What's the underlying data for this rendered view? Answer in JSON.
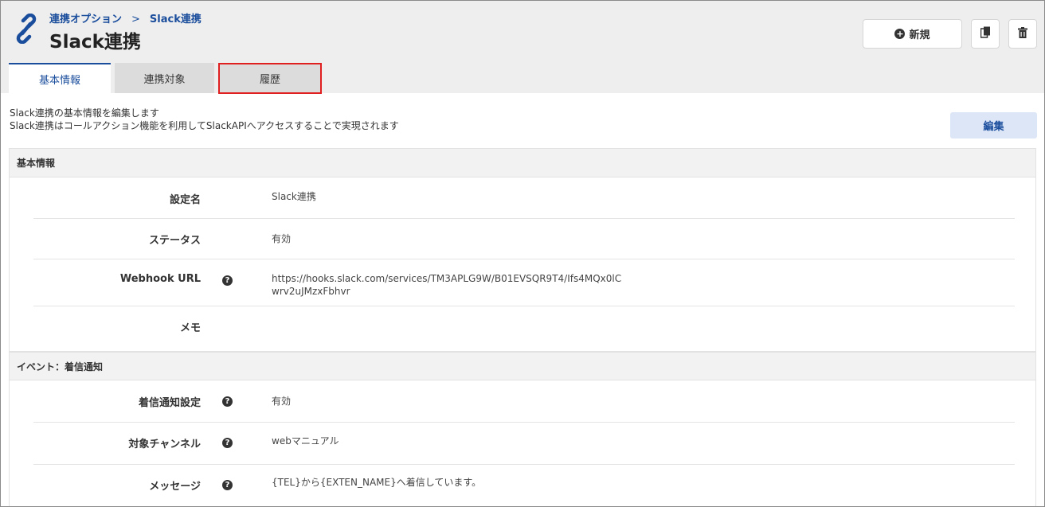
{
  "breadcrumb": {
    "parent": "連携オプション",
    "separator": ">",
    "current": "Slack連携"
  },
  "page": {
    "title": "Slack連携"
  },
  "toolbar": {
    "new_label": "新規",
    "new_icon": "plus-circle-icon",
    "copy_icon": "copy-icon",
    "delete_icon": "trash-icon"
  },
  "tabs": [
    {
      "label": "基本情報",
      "active": true
    },
    {
      "label": "連携対象",
      "active": false
    },
    {
      "label": "履歴",
      "active": false
    }
  ],
  "description": {
    "line1": "Slack連携の基本情報を編集します",
    "line2": "Slack連携はコールアクション機能を利用してSlackAPIへアクセスすることで実現されます"
  },
  "edit_button": {
    "label": "編集"
  },
  "sections": {
    "basic": {
      "title": "基本情報",
      "fields": {
        "name": {
          "label": "設定名",
          "value": "Slack連携"
        },
        "status": {
          "label": "ステータス",
          "value": "有効"
        },
        "webhook": {
          "label": "Webhook URL",
          "value_line1": "https://hooks.slack.com/services/TM3APLG9W/B01EVSQR9T4/Ifs4MQx0lC",
          "value_line2": "wrv2uJMzxFbhvr"
        },
        "memo": {
          "label": "メモ",
          "value": ""
        }
      }
    },
    "event": {
      "title": "イベント：着信通知",
      "fields": {
        "setting": {
          "label": "着信通知設定",
          "value": "有効"
        },
        "channel": {
          "label": "対象チャンネル",
          "value": "webマニュアル"
        },
        "message": {
          "label": "メッセージ",
          "value": "{TEL}から{EXTEN_NAME}へ着信しています。"
        }
      }
    }
  },
  "colors": {
    "accent": "#1a4d9c",
    "highlight_border": "#e02020",
    "header_bg": "#eeeeee",
    "edit_bg": "#dce6f7"
  }
}
